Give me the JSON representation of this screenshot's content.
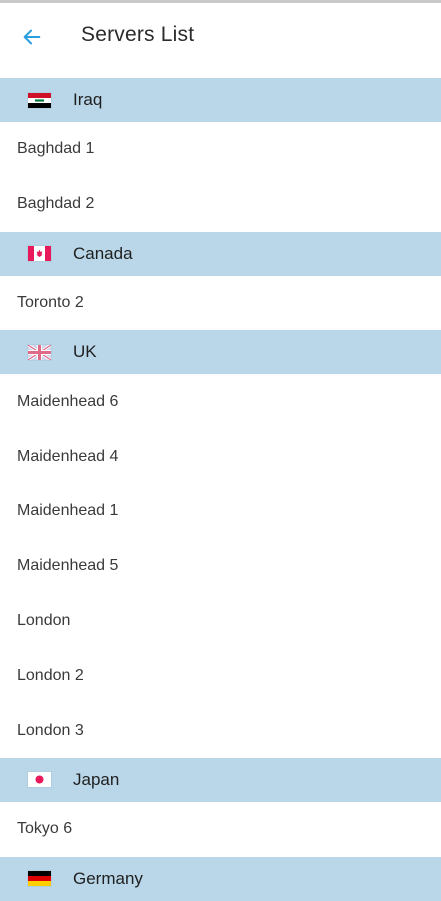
{
  "appbar": {
    "title": "Servers List",
    "back_icon": "arrow-left-icon",
    "accent": "#2a9ee0"
  },
  "colors": {
    "group_header_bg": "#b9d7e8"
  },
  "groups": [
    {
      "country": "Iraq",
      "flag_icon": "iraq-flag-icon",
      "servers": [
        "Baghdad 1",
        "Baghdad 2"
      ]
    },
    {
      "country": "Canada",
      "flag_icon": "canada-flag-icon",
      "servers": [
        "Toronto 2"
      ]
    },
    {
      "country": "UK",
      "flag_icon": "uk-flag-icon",
      "servers": [
        "Maidenhead 6",
        "Maidenhead 4",
        "Maidenhead 1",
        "Maidenhead 5",
        "London",
        "London 2",
        "London 3"
      ]
    },
    {
      "country": "Japan",
      "flag_icon": "japan-flag-icon",
      "servers": [
        "Tokyo 6"
      ]
    },
    {
      "country": "Germany",
      "flag_icon": "germany-flag-icon",
      "servers": []
    }
  ]
}
